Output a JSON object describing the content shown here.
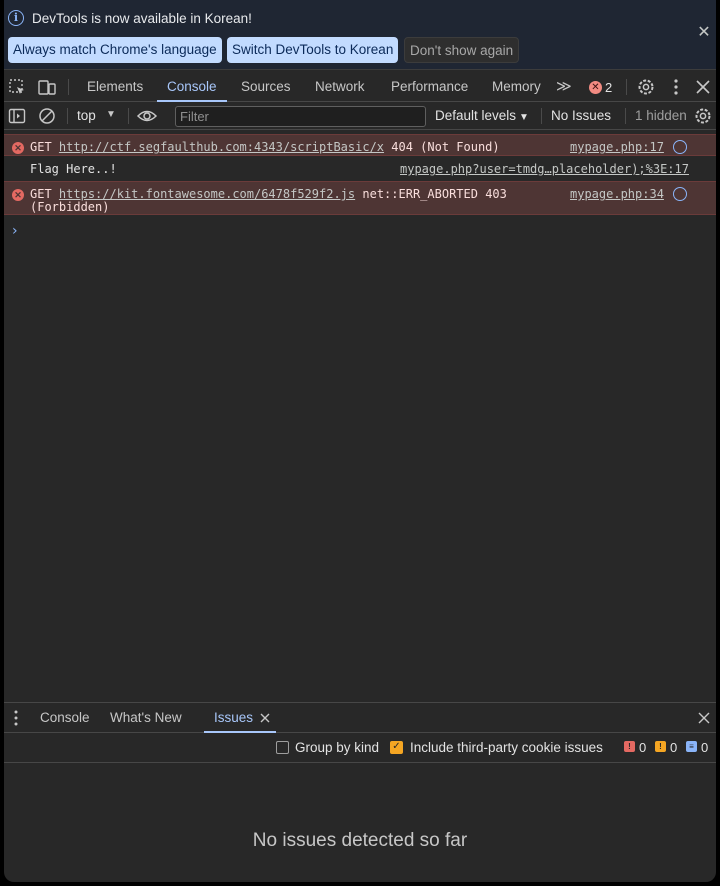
{
  "infobar": {
    "message": "DevTools is now available in Korean!",
    "btn_match": "Always match Chrome's language",
    "btn_switch": "Switch DevTools to Korean",
    "btn_dismiss": "Don't show again",
    "close": "✕"
  },
  "tabs": [
    {
      "label": "Elements"
    },
    {
      "label": "Console"
    },
    {
      "label": "Sources"
    },
    {
      "label": "Network"
    },
    {
      "label": "Performance"
    },
    {
      "label": "Memory"
    }
  ],
  "tabs_more": "≫",
  "error_count": "2",
  "toolbar": {
    "context": "top",
    "filter_placeholder": "Filter",
    "levels": "Default levels",
    "no_issues": "No Issues",
    "hidden": "1 hidden"
  },
  "messages": [
    {
      "type": "error",
      "method": "GET",
      "url": "http://ctf.segfaulthub.com:4343/scriptBasic/x",
      "status": "404 (Not Found)",
      "source": "mypage.php:17"
    },
    {
      "type": "log",
      "text": "Flag Here..!",
      "source": "mypage.php?user=tmdg…placeholder);%3E:17"
    },
    {
      "type": "error",
      "method": "GET",
      "url": "https://kit.fontawesome.com/6478f529f2.js",
      "status": "net::ERR_ABORTED 403",
      "status2": "(Forbidden)",
      "source": "mypage.php:34"
    }
  ],
  "prompt": "›",
  "drawer": {
    "tabs": [
      {
        "label": "Console"
      },
      {
        "label": "What's New"
      },
      {
        "label": "Issues"
      }
    ],
    "group_by_kind": "Group by kind",
    "third_party": "Include third-party cookie issues",
    "counts": {
      "errors": "0",
      "warnings": "0",
      "info": "0"
    },
    "empty": "No issues detected so far"
  },
  "colors": {
    "accent": "#a8c7fa",
    "error_bg": "#4e3534",
    "error_icon": "#e46962",
    "background": "#282828"
  }
}
